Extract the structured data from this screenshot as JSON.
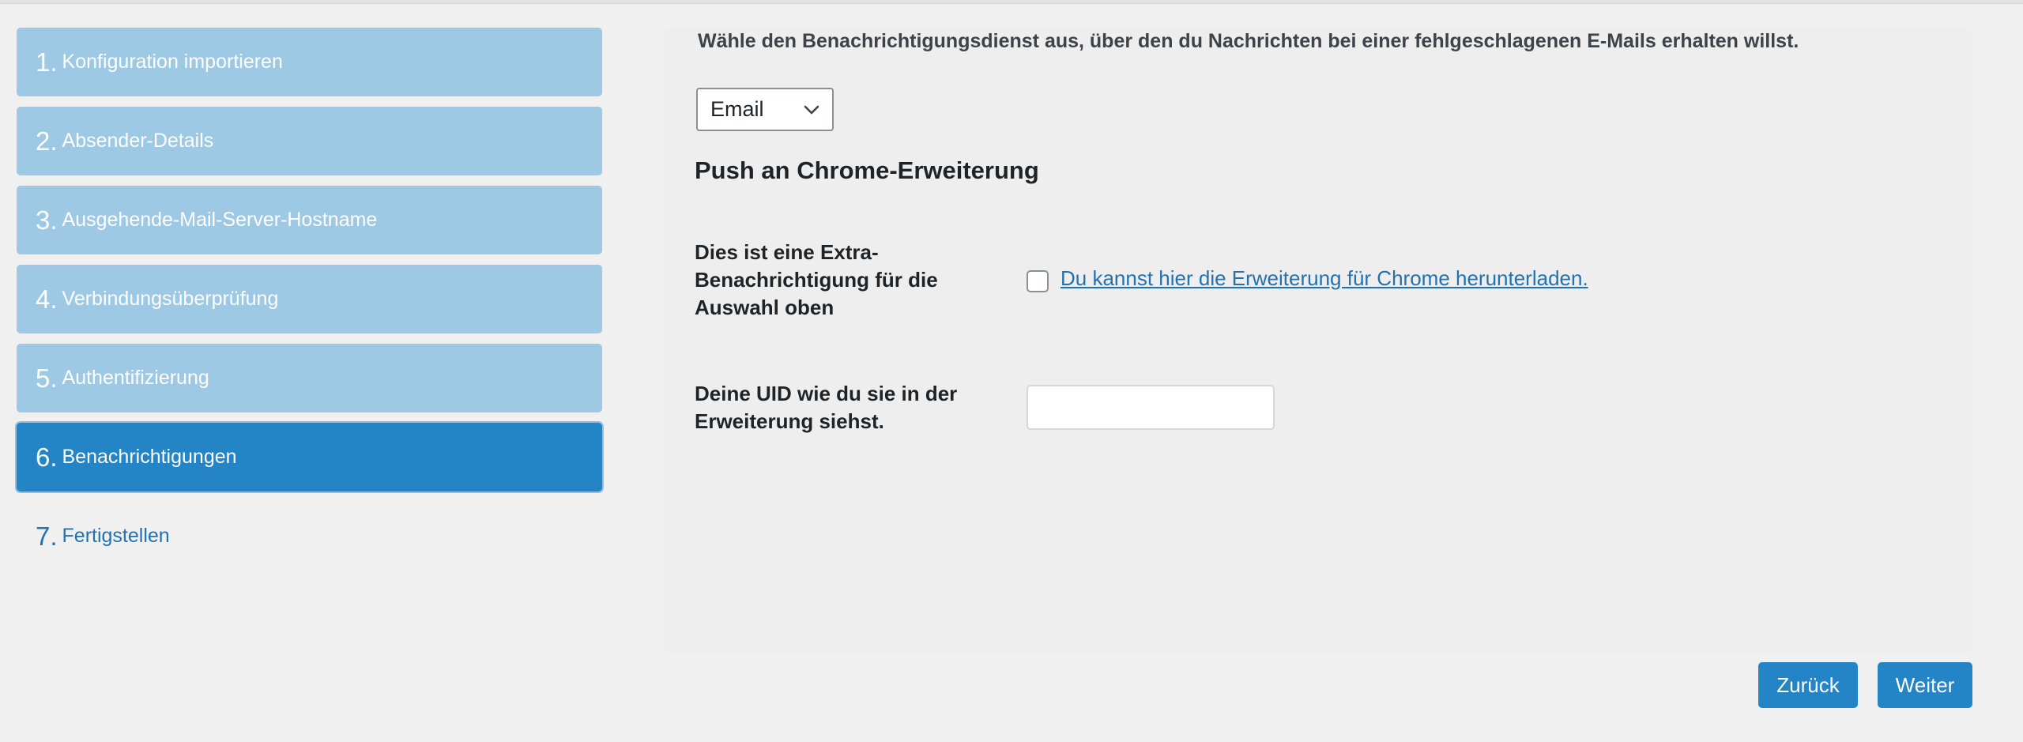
{
  "steps": [
    {
      "num": "1.",
      "label": "Konfiguration importieren"
    },
    {
      "num": "2.",
      "label": "Absender-Details"
    },
    {
      "num": "3.",
      "label": "Ausgehende-Mail-Server-Hostname"
    },
    {
      "num": "4.",
      "label": "Verbindungsüberprüfung"
    },
    {
      "num": "5.",
      "label": "Authentifizierung"
    },
    {
      "num": "6.",
      "label": "Benachrichtigungen",
      "active": true
    },
    {
      "num": "7.",
      "label": "Fertigstellen"
    }
  ],
  "main": {
    "intro": "Wähle den Benachrichtigungsdienst aus, über den du Nachrichten bei einer fehlgeschlagenen E-Mails erhalten willst.",
    "service_select_value": "Email",
    "chevron_icon": "chevron-down-icon",
    "heading": "Push an Chrome-Erweiterung",
    "extra_label": "Dies ist eine Extra-Benachrichtigung für die Auswahl oben",
    "extra_checked": false,
    "download_link": "Du kannst hier die Erweiterung für Chrome herunterladen.",
    "uid_label": "Deine UID wie du sie in der Erweiterung siehst.",
    "uid_value": ""
  },
  "buttons": {
    "back": "Zurück",
    "next": "Weiter"
  },
  "colors": {
    "step_inactive": "#9ec9e5",
    "step_active": "#2384c6",
    "link": "#2271b1",
    "button": "#2384c6"
  }
}
